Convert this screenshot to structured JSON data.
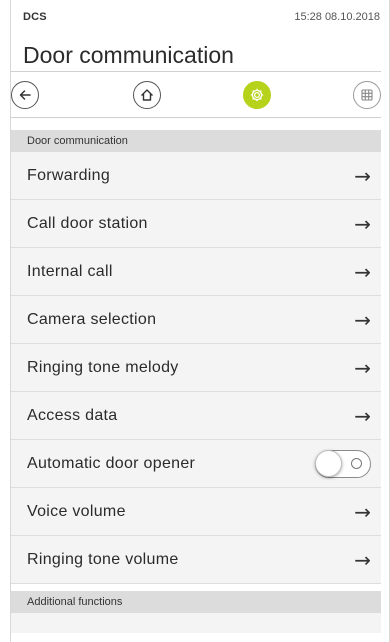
{
  "status": {
    "app": "DCS",
    "time": "15:28 08.10.2018"
  },
  "title": "Door communication",
  "toolbar": {
    "back_icon": "back-arrow-icon",
    "home_icon": "home-icon",
    "settings_icon": "gear-icon",
    "grid_icon": "grid-icon",
    "accent": "#b6d21a"
  },
  "section1": {
    "header": "Door communication"
  },
  "items": [
    {
      "label": "Forwarding",
      "control": "arrow"
    },
    {
      "label": "Call door station",
      "control": "arrow"
    },
    {
      "label": "Internal call",
      "control": "arrow"
    },
    {
      "label": "Camera selection",
      "control": "arrow"
    },
    {
      "label": "Ringing tone melody",
      "control": "arrow"
    },
    {
      "label": "Access data",
      "control": "arrow"
    },
    {
      "label": "Automatic door opener",
      "control": "toggle",
      "state": "off"
    },
    {
      "label": "Voice volume",
      "control": "arrow"
    },
    {
      "label": "Ringing tone volume",
      "control": "arrow"
    }
  ],
  "arrow_glyph": "→",
  "section2": {
    "header": "Additional functions"
  }
}
